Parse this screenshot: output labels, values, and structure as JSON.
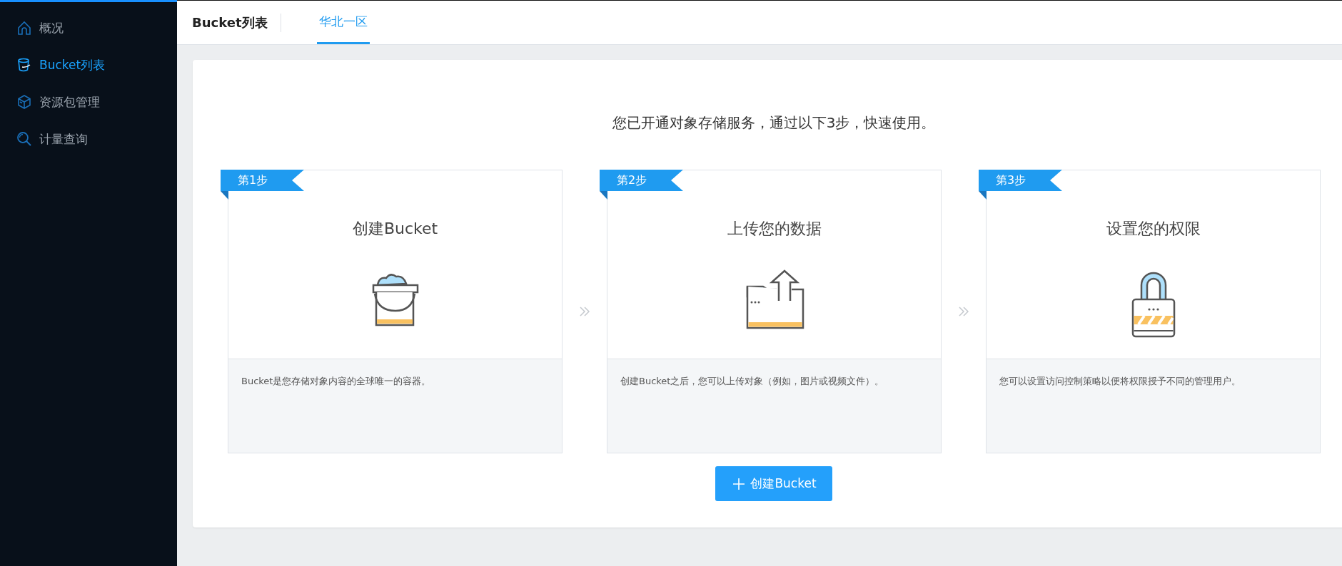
{
  "sidebar": {
    "items": [
      {
        "label": "概况",
        "kind": "home",
        "selected": false
      },
      {
        "label": "Bucket列表",
        "kind": "bucket",
        "selected": true
      },
      {
        "label": "资源包管理",
        "kind": "cube",
        "selected": false
      },
      {
        "label": "计量查询",
        "kind": "search",
        "selected": false
      }
    ]
  },
  "header": {
    "title": "Bucket列表",
    "tabs": [
      {
        "label": "华北一区",
        "selected": true
      }
    ]
  },
  "main": {
    "heading": "您已开通对象存储服务，通过以下3步，快速使用。",
    "steps": [
      {
        "badge": "第1步",
        "title": "创建Bucket",
        "kind": "bucket",
        "description": "Bucket是您存储对象内容的全球唯一的容器。"
      },
      {
        "badge": "第2步",
        "title": "上传您的数据",
        "kind": "upload",
        "description": "创建Bucket之后，您可以上传对象（例如，图片或视频文件）。"
      },
      {
        "badge": "第3步",
        "title": "设置您的权限",
        "kind": "lock",
        "description": "您可以设置访问控制策略以便将权限授予不同的管理用户。"
      }
    ],
    "button": {
      "label": "创建Bucket"
    }
  }
}
